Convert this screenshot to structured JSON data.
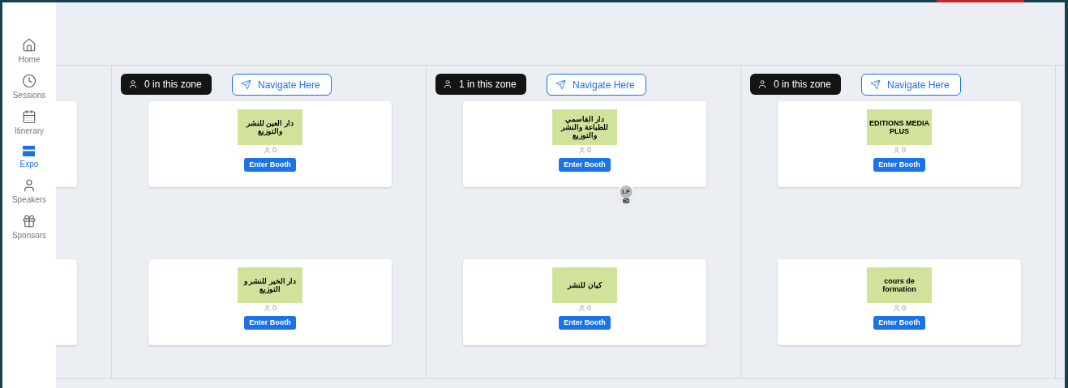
{
  "sidebar": {
    "items": [
      {
        "label": "Home",
        "selected": false
      },
      {
        "label": "Sessions",
        "selected": false
      },
      {
        "label": "Itinerary",
        "selected": false
      },
      {
        "label": "Expo",
        "selected": true
      },
      {
        "label": "Speakers",
        "selected": false
      },
      {
        "label": "Sponsors",
        "selected": false
      }
    ]
  },
  "zones": [
    {
      "count": "0 in this zone",
      "navigate": "Navigate Here",
      "booths": [
        {
          "logo_text": "دار العين للنشر والتوزيع",
          "visitors": "0",
          "button": "Enter Booth"
        },
        {
          "logo_text": "دار الخير للنشر و التوزيع",
          "visitors": "0",
          "button": "Enter Booth"
        }
      ]
    },
    {
      "count": "1 in this zone",
      "navigate": "Navigate Here",
      "booths": [
        {
          "logo_text": "دار القاسمي للطباعة والنشر والتوزيع",
          "visitors": "0",
          "button": "Enter Booth"
        },
        {
          "logo_text": "كيان للنشر",
          "visitors": "0",
          "button": "Enter Booth"
        }
      ]
    },
    {
      "count": "0 in this zone",
      "navigate": "Navigate Here",
      "booths": [
        {
          "logo_text": "EDITIONS MEDIA PLUS",
          "visitors": "0",
          "button": "Enter Booth"
        },
        {
          "logo_text": "cours de formation",
          "visitors": "0",
          "button": "Enter Booth"
        }
      ]
    }
  ],
  "attendee": {
    "initials": "LF"
  }
}
